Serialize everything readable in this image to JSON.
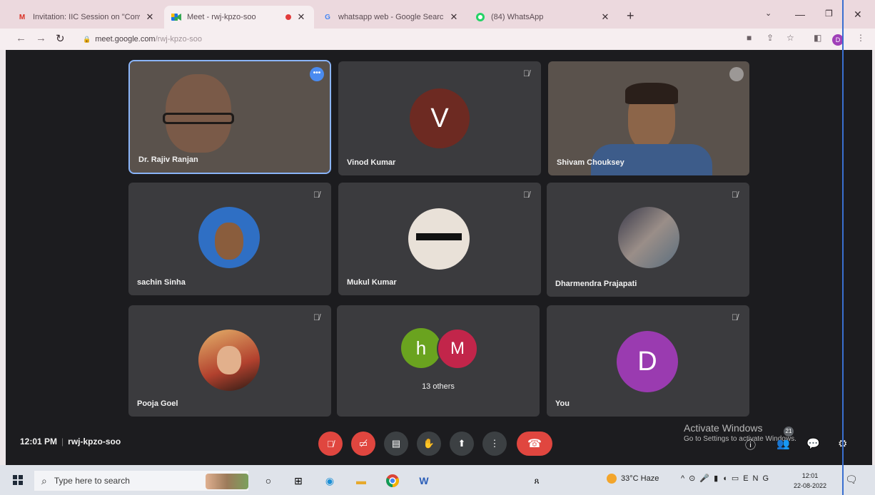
{
  "browser": {
    "tabs": [
      {
        "title": "Invitation: IIC Session on \"Conv",
        "icon": "gmail-icon",
        "active": false
      },
      {
        "title": "Meet - rwj-kpzo-soo",
        "icon": "meet-icon",
        "active": true,
        "recording": true
      },
      {
        "title": "whatsapp web - Google Search",
        "icon": "google-icon",
        "active": false
      },
      {
        "title": "(84) WhatsApp",
        "icon": "whatsapp-icon",
        "active": false
      }
    ],
    "url_host": "meet.google.com",
    "url_path": "/rwj-kpzo-soo",
    "profile_initial": "D"
  },
  "meet": {
    "participants": [
      {
        "name": "Dr. Rajiv Ranjan",
        "type": "video"
      },
      {
        "name": "Vinod Kumar",
        "initial": "V",
        "avatar_color": "#6d2a22"
      },
      {
        "name": "Shivam Chouksey",
        "type": "video"
      },
      {
        "name": "sachin Sinha",
        "type": "photo"
      },
      {
        "name": "Mukul Kumar",
        "type": "photo"
      },
      {
        "name": "Dharmendra Prajapati",
        "type": "photo"
      },
      {
        "name": "Pooja Goel",
        "type": "photo"
      },
      {
        "name": "13 others",
        "initials": [
          "h",
          "M"
        ],
        "colors": [
          "#6aa31f",
          "#c2254a"
        ]
      },
      {
        "name": "You",
        "initial": "D",
        "avatar_color": "#9a3bb0"
      }
    ],
    "time": "12:01 PM",
    "meeting_code": "rwj-kpzo-soo",
    "people_count": "21",
    "watermark": {
      "line1": "Activate Windows",
      "line2": "Go to Settings to activate Windows."
    }
  },
  "taskbar": {
    "search_placeholder": "Type here to search",
    "weather": "33°C  Haze",
    "language": "ENG",
    "time": "12:01",
    "date": "22-08-2022"
  }
}
